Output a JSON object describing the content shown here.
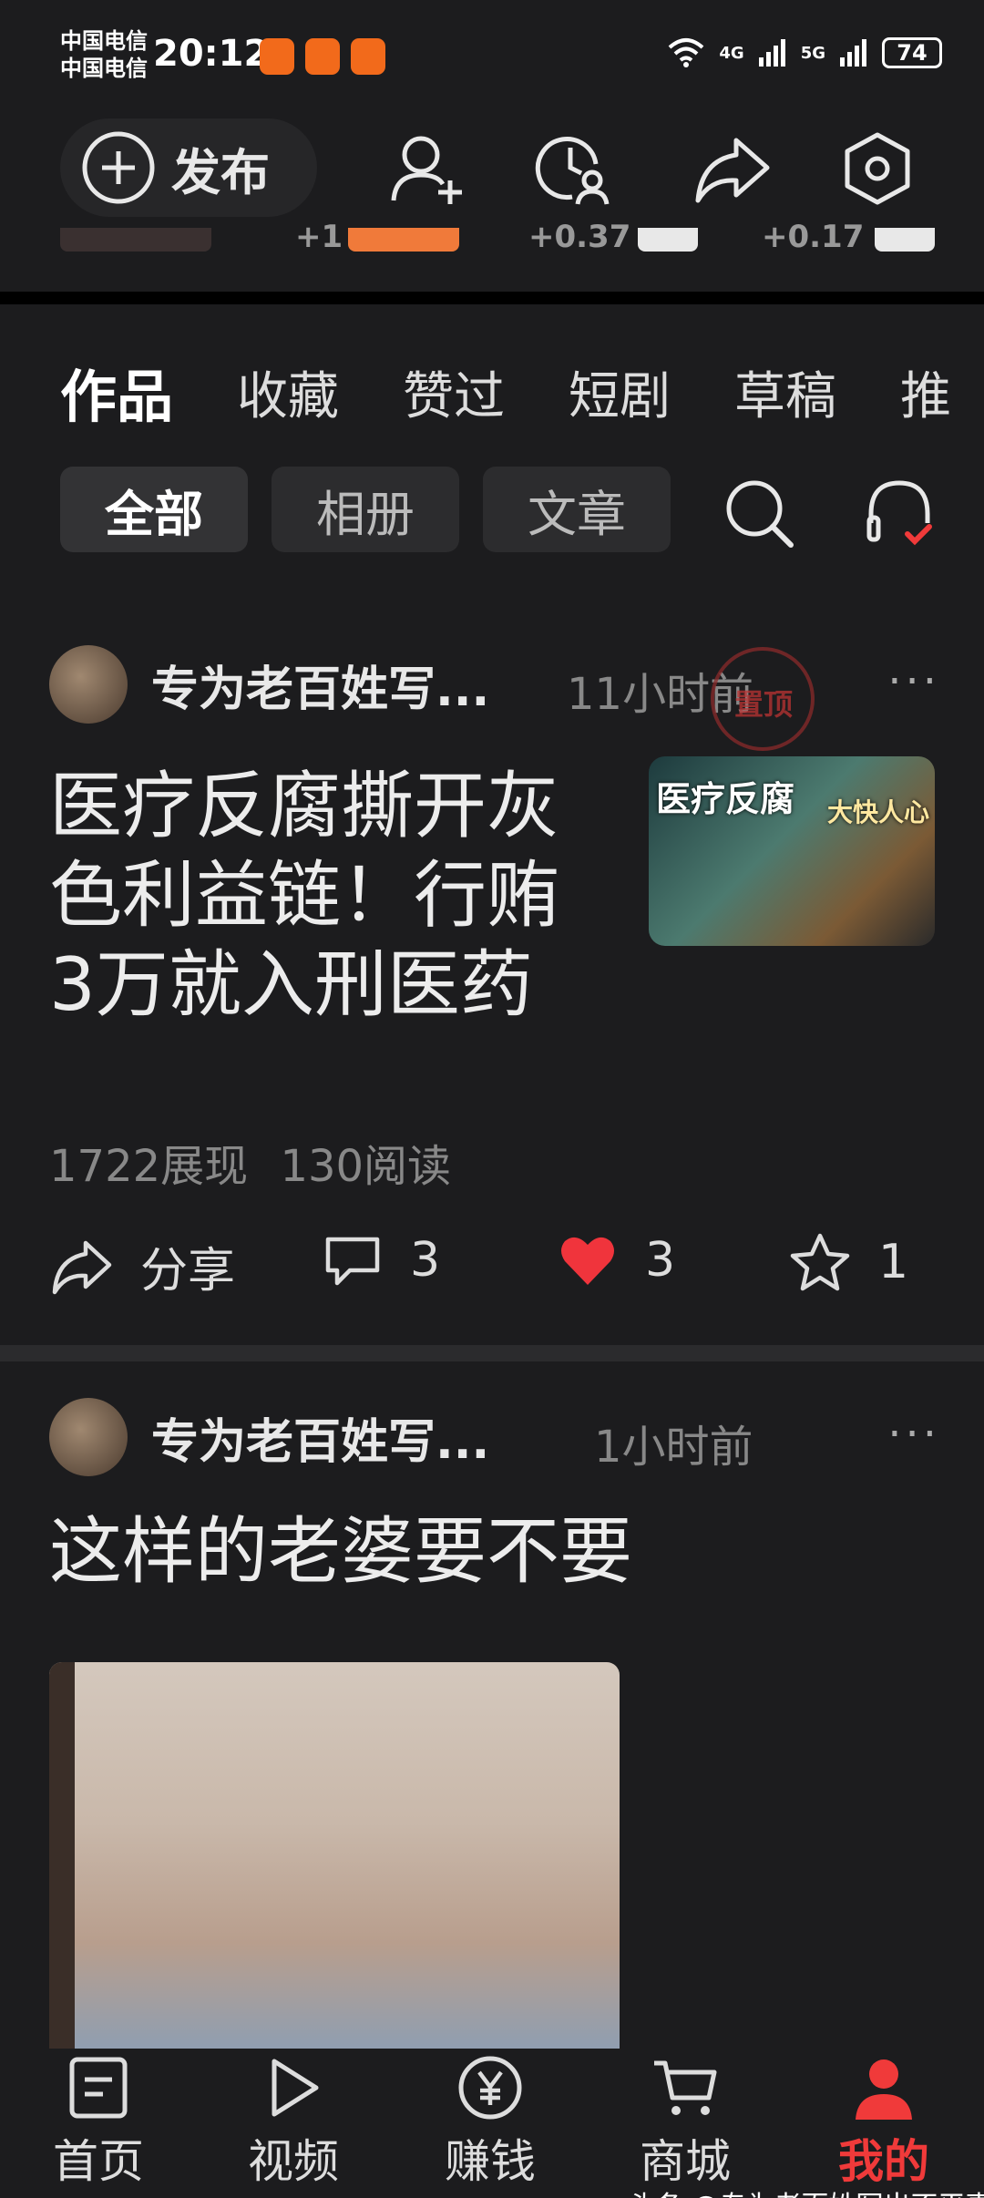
{
  "status_bar": {
    "carrier_1": "中国电信",
    "carrier_2": "中国电信",
    "time": "20:12",
    "net_4g": "4G",
    "net_5g": "5G",
    "battery": "74"
  },
  "top_bar": {
    "publish_label": "发布"
  },
  "peek": {
    "values": [
      "+1",
      "+0.37",
      "+0.17"
    ]
  },
  "tabs": {
    "items": [
      "作品",
      "收藏",
      "赞过",
      "短剧",
      "草稿",
      "推"
    ],
    "active": "作品"
  },
  "chips": {
    "items": [
      "全部",
      "相册",
      "文章"
    ]
  },
  "posts": [
    {
      "author": "专为老百姓写...",
      "time": "11小时前",
      "more": "···",
      "title_lines": [
        "医疗反腐撕开灰",
        "色利益链！行贿",
        "3万就入刑医药"
      ],
      "thumb_text_left": "医疗反腐",
      "thumb_text_right": "大快人心",
      "seal_text": "置顶",
      "impressions": "1722展现",
      "reads": "130阅读",
      "share_label": "分享",
      "comments": "3",
      "likes": "3",
      "favorites": "1"
    },
    {
      "author": "专为老百姓写...",
      "time": "1小时前",
      "more": "···",
      "title": "这样的老婆要不要"
    }
  ],
  "bottom_nav": {
    "items": [
      "首页",
      "视频",
      "赚钱",
      "商城",
      "我的"
    ],
    "active": "我的"
  },
  "watermark": "头条 @专为老百姓写出不平事",
  "colors": {
    "background": "#1c1c1e",
    "accent_red": "#f03a3a",
    "like_red": "#f0343c"
  }
}
